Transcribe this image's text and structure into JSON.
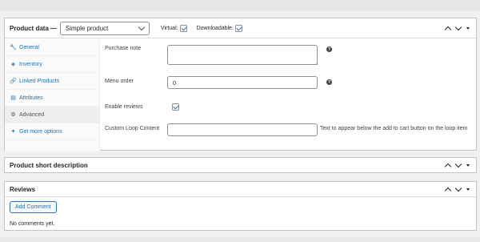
{
  "product_data": {
    "title": "Product data",
    "dash": "—",
    "type_select": "Simple product",
    "virtual_label": "Virtual:",
    "virtual_checked": true,
    "downloadable_label": "Downloadable:",
    "downloadable_checked": true,
    "tabs": [
      {
        "label": "General",
        "icon": "wrench-icon",
        "glyph": "🔧"
      },
      {
        "label": "Inventory",
        "icon": "tag-icon",
        "glyph": "◈"
      },
      {
        "label": "Linked Products",
        "icon": "link-icon",
        "glyph": "🔗"
      },
      {
        "label": "Attributes",
        "icon": "list-icon",
        "glyph": "▤"
      },
      {
        "label": "Advanced",
        "icon": "gear-icon",
        "glyph": "⚙"
      },
      {
        "label": "Get more options",
        "icon": "plugin-icon",
        "glyph": "✦"
      }
    ],
    "active_tab": "Advanced",
    "fields": {
      "purchase_note_label": "Purchase note",
      "purchase_note_value": "",
      "menu_order_label": "Menu order",
      "menu_order_value": "0",
      "enable_reviews_label": "Enable reviews",
      "enable_reviews_checked": true,
      "custom_loop_label": "Custom Loop Content",
      "custom_loop_value": "",
      "custom_loop_desc": "Text to appear below the add to cart button on the loop item"
    },
    "help_glyph": "?"
  },
  "short_description": {
    "title": "Product short description"
  },
  "reviews": {
    "title": "Reviews",
    "add_button": "Add Comment",
    "empty_text": "No comments yet."
  },
  "colors": {
    "link": "#2271b1",
    "border": "#c3c4c7",
    "background": "#f0f0f1"
  }
}
